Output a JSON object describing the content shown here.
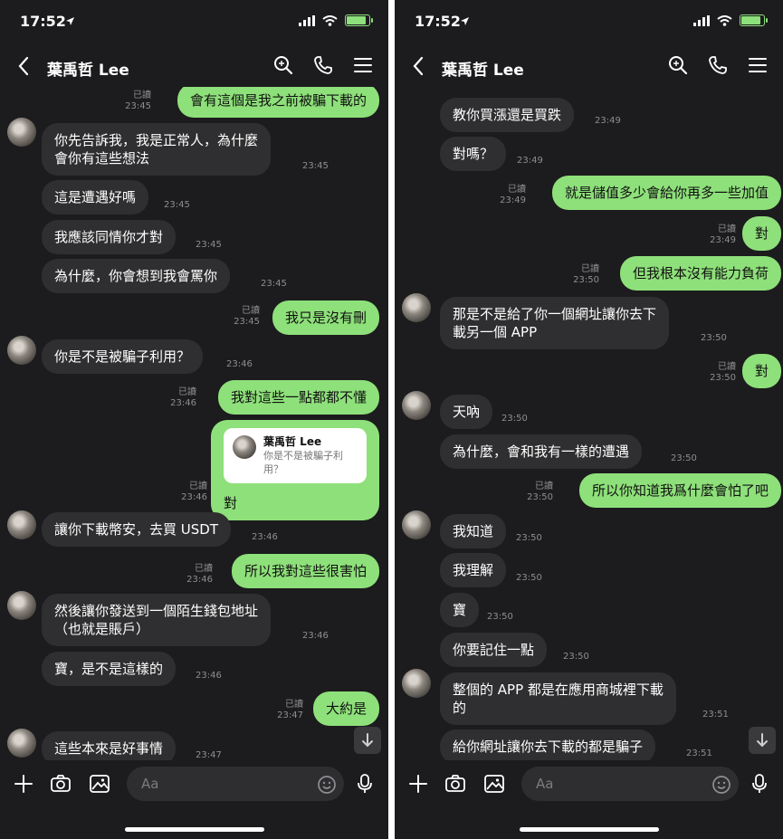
{
  "screens": [
    {
      "status_time": "17:52",
      "title": "葉禹哲 Lee",
      "input_placeholder": "Aa",
      "reply_quote": {
        "name": "葉禹哲 Lee",
        "text": "你是不是被騙子利用？"
      },
      "messages": [
        {
          "dir": "out",
          "text": "會有這個是我之前被騙下載的",
          "read": "已讀",
          "time": "23:45"
        },
        {
          "dir": "in",
          "text": "你先告訴我，我是正常人，為什麼\n會你有這些想法",
          "time": "23:45",
          "avatar": true
        },
        {
          "dir": "in",
          "text": "這是遭遇好嗎",
          "time": "23:45"
        },
        {
          "dir": "in",
          "text": "我應該同情你才對",
          "time": "23:45"
        },
        {
          "dir": "in",
          "text": "為什麼，你會想到我會罵你",
          "time": "23:45"
        },
        {
          "dir": "out",
          "text": "我只是沒有刪",
          "read": "已讀",
          "time": "23:45"
        },
        {
          "dir": "in",
          "text": "你是不是被騙子利用？",
          "time": "23:46",
          "avatar": true
        },
        {
          "dir": "out",
          "text": "我對這些一點都都不懂",
          "read": "已讀",
          "time": "23:46"
        },
        {
          "dir": "out",
          "text": "對",
          "read": "已讀",
          "time": "23:46",
          "reply": true
        },
        {
          "dir": "in",
          "text": "讓你下載幣安，去買 USDT",
          "time": "23:46",
          "avatar": true
        },
        {
          "dir": "out",
          "text": "所以我對這些很害怕",
          "read": "已讀",
          "time": "23:46"
        },
        {
          "dir": "in",
          "text": "然後讓你發送到一個陌生錢包地址\n（也就是賬戶）",
          "time": "23:46",
          "avatar": true
        },
        {
          "dir": "in",
          "text": "寶，是不是這樣的",
          "time": "23:46"
        },
        {
          "dir": "out",
          "text": "大約是",
          "read": "已讀",
          "time": "23:47"
        },
        {
          "dir": "in",
          "text": "這些本來是好事情",
          "time": "23:47",
          "avatar": true
        }
      ]
    },
    {
      "status_time": "17:52",
      "title": "葉禹哲 Lee",
      "input_placeholder": "Aa",
      "messages": [
        {
          "dir": "in",
          "text": "教你買漲還是買跌",
          "time": "23:49"
        },
        {
          "dir": "in",
          "text": "對嗎？",
          "time": "23:49"
        },
        {
          "dir": "out",
          "text": "就是儲值多少會給你再多一些加值",
          "read": "已讀",
          "time": "23:49"
        },
        {
          "dir": "out",
          "text": "對",
          "read": "已讀",
          "time": "23:49"
        },
        {
          "dir": "out",
          "text": "但我根本沒有能力負荷",
          "read": "已讀",
          "time": "23:50"
        },
        {
          "dir": "in",
          "text": "那是不是給了你一個網址讓你去下\n載另一個 APP",
          "time": "23:50",
          "avatar": true
        },
        {
          "dir": "out",
          "text": "對",
          "read": "已讀",
          "time": "23:50"
        },
        {
          "dir": "in",
          "text": "天吶",
          "time": "23:50",
          "avatar": true
        },
        {
          "dir": "in",
          "text": "為什麼，會和我有一樣的遭遇",
          "time": "23:50"
        },
        {
          "dir": "out",
          "text": "所以你知道我爲什麼會怕了吧",
          "read": "已讀",
          "time": "23:50"
        },
        {
          "dir": "in",
          "text": "我知道",
          "time": "23:50",
          "avatar": true
        },
        {
          "dir": "in",
          "text": "我理解",
          "time": "23:50"
        },
        {
          "dir": "in",
          "text": "寶",
          "time": "23:50"
        },
        {
          "dir": "in",
          "text": "你要記住一點",
          "time": "23:50"
        },
        {
          "dir": "in",
          "text": "整個的 APP 都是在應用商城裡下載\n的",
          "time": "23:51",
          "avatar": true
        },
        {
          "dir": "in",
          "text": "給你網址讓你去下載的都是騙子",
          "time": "23:51"
        }
      ]
    }
  ],
  "colors": {
    "background": "#1c1c1e",
    "bubble_in": "#2f2f31",
    "bubble_out": "#8ee07a",
    "meta": "#8e8e93"
  },
  "icons": [
    "location-arrow-icon",
    "signal-icon",
    "wifi-icon",
    "battery-icon",
    "back-icon",
    "search-icon",
    "phone-icon",
    "menu-icon",
    "plus-icon",
    "camera-icon",
    "image-icon",
    "emoji-icon",
    "microphone-icon",
    "arrow-down-icon"
  ]
}
